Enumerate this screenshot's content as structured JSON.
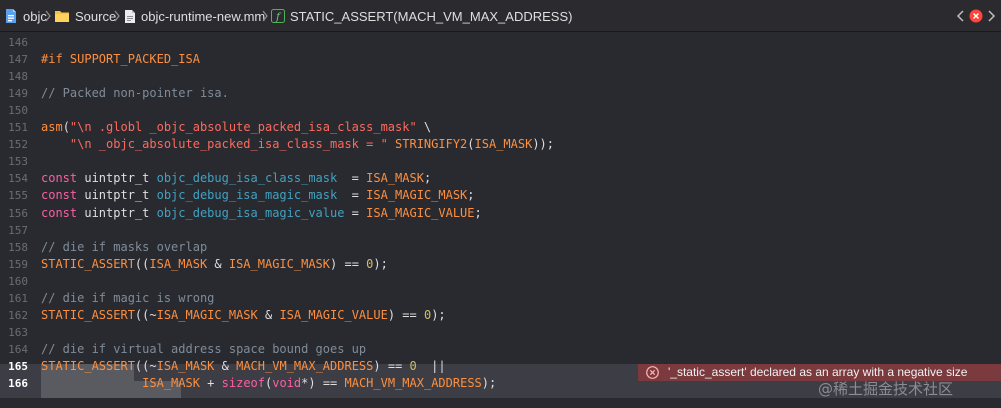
{
  "jumpbar": {
    "crumbs": [
      "objc",
      "Source",
      "objc-runtime-new.mm",
      "STATIC_ASSERT(MACH_VM_MAX_ADDRESS)"
    ],
    "icons": [
      "project-icon",
      "folder-icon",
      "file-icon",
      "function-icon"
    ],
    "error_badge_color": "#ff453a"
  },
  "editor": {
    "lines": [
      {
        "num": "146",
        "html": ""
      },
      {
        "num": "147",
        "html": "<span style=\"color:#fd8f3f\">#if SUPPORT_PACKED_ISA</span>"
      },
      {
        "num": "148",
        "html": ""
      },
      {
        "num": "149",
        "html": "<span style=\"color:#7f8c98\">// Packed non-pointer isa.</span>"
      },
      {
        "num": "150",
        "html": ""
      },
      {
        "num": "151",
        "html": "<span style=\"color:#fd8f3f\">asm</span>(<span style=\"color:#fc6a5d\">\"\\n .globl _objc_absolute_packed_isa_class_mask\"</span> \\"
      },
      {
        "num": "152",
        "html": "    <span style=\"color:#fc6a5d\">\"\\n _objc_absolute_packed_isa_class_mask = \"</span> <span style=\"color:#fd8f3f\">STRINGIFY2</span>(<span style=\"color:#fd8f3f\">ISA_MASK</span>));"
      },
      {
        "num": "153",
        "html": ""
      },
      {
        "num": "154",
        "html": "<span style=\"color:#fc5fa3\">const</span> uintptr_t <span style=\"color:#41a1c0\">objc_debug_isa_class_mask</span>  = <span style=\"color:#fd8f3f\">ISA_MASK</span>;"
      },
      {
        "num": "155",
        "html": "<span style=\"color:#fc5fa3\">const</span> uintptr_t <span style=\"color:#41a1c0\">objc_debug_isa_magic_mask</span>  = <span style=\"color:#fd8f3f\">ISA_MAGIC_MASK</span>;"
      },
      {
        "num": "156",
        "html": "<span style=\"color:#fc5fa3\">const</span> uintptr_t <span style=\"color:#41a1c0\">objc_debug_isa_magic_value</span> = <span style=\"color:#fd8f3f\">ISA_MAGIC_VALUE</span>;"
      },
      {
        "num": "157",
        "html": ""
      },
      {
        "num": "158",
        "html": "<span style=\"color:#7f8c98\">// die if masks overlap</span>"
      },
      {
        "num": "159",
        "html": "<span style=\"color:#fd8f3f\">STATIC_ASSERT</span>((<span style=\"color:#fd8f3f\">ISA_MASK</span> &amp; <span style=\"color:#fd8f3f\">ISA_MAGIC_MASK</span>) == <span style=\"color:#d0bf69\">0</span>);"
      },
      {
        "num": "160",
        "html": ""
      },
      {
        "num": "161",
        "html": "<span style=\"color:#7f8c98\">// die if magic is wrong</span>"
      },
      {
        "num": "162",
        "html": "<span style=\"color:#fd8f3f\">STATIC_ASSERT</span>((~<span style=\"color:#fd8f3f\">ISA_MAGIC_MASK</span> &amp; <span style=\"color:#fd8f3f\">ISA_MAGIC_VALUE</span>) == <span style=\"color:#d0bf69\">0</span>);"
      },
      {
        "num": "163",
        "html": ""
      },
      {
        "num": "164",
        "html": "<span style=\"color:#7f8c98\">// die if virtual address space bound goes up</span>"
      },
      {
        "num": "165",
        "html": "<span style=\"color:#fd8f3f\">STATIC_ASSERT</span>((~<span style=\"color:#fd8f3f\">ISA_MASK</span> &amp; <span style=\"color:#fd8f3f\">MACH_VM_MAX_ADDRESS</span>) == <span style=\"color:#d0bf69\">0</span>  ||",
        "current": true
      },
      {
        "num": "166",
        "html": "              <span style=\"color:#fd8f3f\">ISA_MASK</span> + <span style=\"color:#fc5fa3\">sizeof</span>(<span style=\"color:#fc5fa3\">void</span>*) == <span style=\"color:#fd8f3f\">MACH_VM_MAX_ADDRESS</span>);",
        "current": true
      }
    ]
  },
  "error": {
    "message": "'_static_assert' declared as an array with a negative size",
    "color": "#7a3a3e"
  },
  "watermark": "@稀土掘金技术社区"
}
